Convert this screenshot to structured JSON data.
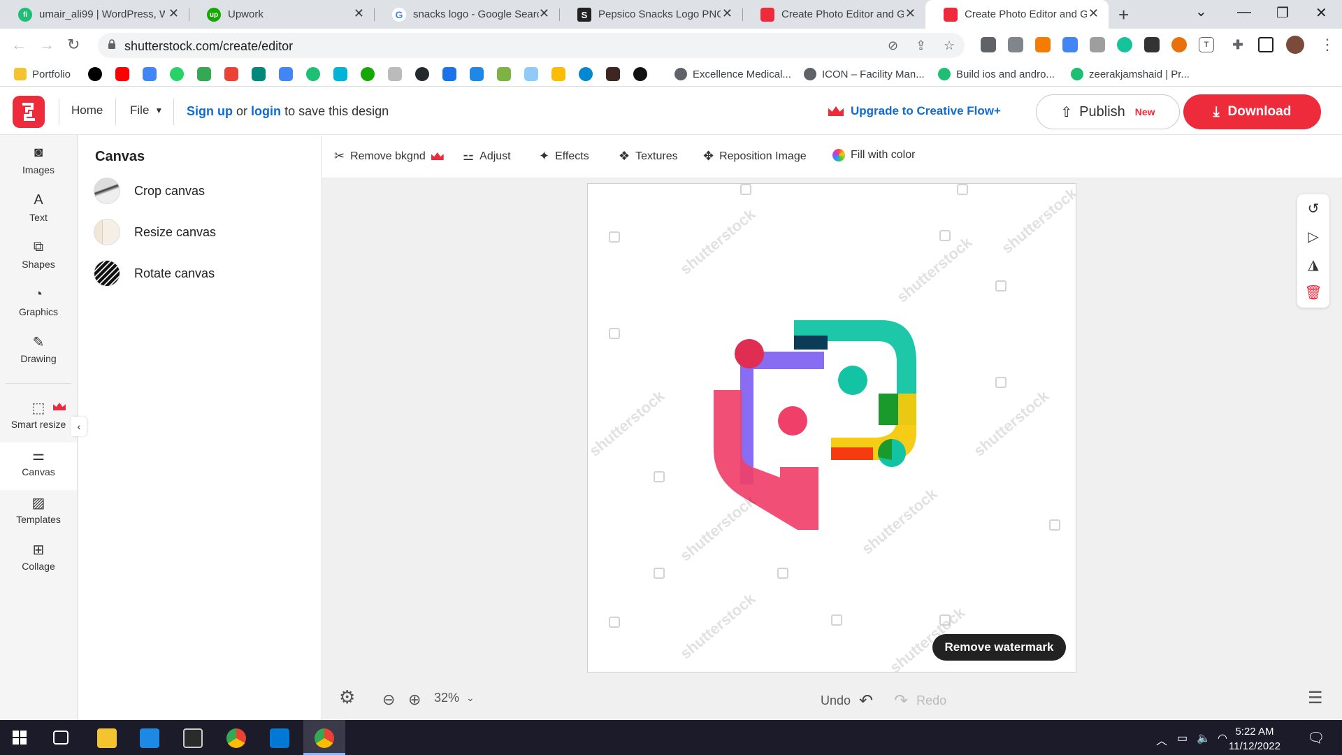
{
  "browser": {
    "tabs": [
      {
        "title": "umair_ali99 | WordPress, W",
        "favicon": "fiverr-icon",
        "color": "#1dbf73",
        "glyph": "fi"
      },
      {
        "title": "Upwork",
        "favicon": "upwork-icon",
        "color": "#14a800",
        "glyph": "up"
      },
      {
        "title": "snacks logo - Google Searc",
        "favicon": "google-icon",
        "color": "#4285f4",
        "glyph": "G"
      },
      {
        "title": "Pepsico Snacks Logo PNG V",
        "favicon": "s-icon",
        "color": "#222222",
        "glyph": "S"
      },
      {
        "title": "Create Photo Editor and Gr",
        "favicon": "shutterstock-icon",
        "color": "#ee2b3b",
        "glyph": ""
      },
      {
        "title": "Create Photo Editor and Gr",
        "favicon": "shutterstock-icon",
        "color": "#ee2b3b",
        "glyph": ""
      }
    ],
    "url": "shutterstock.com/create/editor",
    "bookmarks": [
      {
        "label": "Portfolio"
      },
      {
        "label": "Excellence Medical..."
      },
      {
        "label": "ICON – Facility Man..."
      },
      {
        "label": "Build ios and andro..."
      },
      {
        "label": "zeerakjamshaid | Pr..."
      }
    ]
  },
  "header": {
    "home": "Home",
    "file": "File",
    "signup": "Sign up",
    "or": "or",
    "login": "login",
    "save_text": "to save this design",
    "upgrade": "Upgrade to Creative Flow+",
    "publish": "Publish",
    "publish_badge": "New",
    "download": "Download"
  },
  "rail": {
    "items": [
      {
        "label": "Images",
        "icon": "camera-icon"
      },
      {
        "label": "Text",
        "icon": "text-icon"
      },
      {
        "label": "Shapes",
        "icon": "shapes-icon"
      },
      {
        "label": "Graphics",
        "icon": "graphics-icon"
      },
      {
        "label": "Drawing",
        "icon": "pen-icon"
      },
      {
        "label": "Smart resize",
        "icon": "resize-icon"
      },
      {
        "label": "Canvas",
        "icon": "sliders-icon"
      },
      {
        "label": "Templates",
        "icon": "templates-icon"
      },
      {
        "label": "Collage",
        "icon": "collage-icon"
      }
    ]
  },
  "panel": {
    "title": "Canvas",
    "items": [
      {
        "label": "Crop canvas"
      },
      {
        "label": "Resize canvas"
      },
      {
        "label": "Rotate canvas"
      }
    ]
  },
  "toolbar": {
    "remove_bg": "Remove bkgnd",
    "adjust": "Adjust",
    "effects": "Effects",
    "textures": "Textures",
    "reposition": "Reposition Image",
    "fill": "Fill with color"
  },
  "canvas": {
    "remove_watermark": "Remove watermark",
    "watermark_text": "shutterstock",
    "zoom": "32%",
    "undo": "Undo",
    "redo": "Redo"
  },
  "taskbar": {
    "time": "5:22 AM",
    "date": "11/12/2022"
  },
  "colors": {
    "brand_red": "#ee2b3b",
    "link_blue": "#0f6bd6",
    "logo_purple": "#7b5cf0",
    "logo_teal": "#12c4a3",
    "logo_pink": "#f0406a",
    "logo_yellow": "#f5c90a"
  }
}
